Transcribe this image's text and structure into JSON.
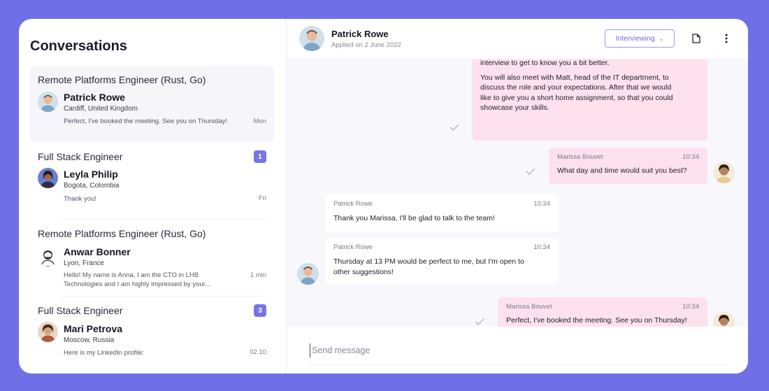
{
  "sidebar": {
    "title": "Conversations",
    "conversations": [
      {
        "job": "Remote Platforms Engineer (Rust, Go)",
        "name": "Patrick Rowe",
        "location": "Cardiff, United Kingdom",
        "message": "Perfect, I've booked the meeting. See you on Thursday!",
        "time": "Mon",
        "badge": null,
        "active": true
      },
      {
        "job": "Full Stack Engineer",
        "name": "Leyla Philip",
        "location": "Bogota, Colombia",
        "message": "Thank you!",
        "time": "Fri",
        "badge": "1"
      },
      {
        "job": "Remote Platforms Engineer (Rust, Go)",
        "name": "Anwar Bonner",
        "location": "Lyon, France",
        "message": "Hello! My name is Anna, I am the CTO in LHB Technologies and I am highly impressed by your...",
        "time": "1 min",
        "badge": null
      },
      {
        "job": "Full Stack Engineer",
        "name": "Mari Petrova",
        "location": "Moscow, Russia",
        "message": "Here is my LinkedIn profile:",
        "time": "02.10",
        "badge": "3"
      }
    ]
  },
  "header": {
    "name": "Patrick Rowe",
    "subtitle": "Applied on 2 June 2022",
    "status": "Interviewing"
  },
  "messages": [
    {
      "direction": "out",
      "lines": [
        "interview to get to know you a bit better.",
        "",
        "You will also meet with Matt, head of the IT department, to",
        "discuss the role and your expectations. After that we would",
        "like to give you a short home assignment, so that you could",
        "showcase your skills."
      ]
    },
    {
      "direction": "out",
      "sender": "Marissa Bouvet",
      "time": "10:34",
      "text": "What day and time would suit you best?"
    },
    {
      "direction": "in",
      "sender": "Patrick Rowe",
      "time": "10:34",
      "text": "Thank you Marissa, I'll be glad to talk to the team!"
    },
    {
      "direction": "in",
      "sender": "Patrick Rowe",
      "time": "10:34",
      "lines": [
        "Thursday at 13 PM would be perfect to me, but I'm open to",
        "other suggestions!"
      ]
    },
    {
      "direction": "out",
      "sender": "Marissa Bouvet",
      "time": "10:34",
      "text": "Perfect, I've booked the meeting. See you on Thursday!"
    }
  ],
  "composer": {
    "placeholder": "Send message"
  },
  "icons": {
    "document": "document-icon",
    "more": "more-vertical-icon",
    "check": "check-icon"
  },
  "colors": {
    "background": "#6f6fe8",
    "accent": "#7575e6",
    "outgoing_bubble": "#fde1ec",
    "incoming_bubble": "#ffffff"
  }
}
